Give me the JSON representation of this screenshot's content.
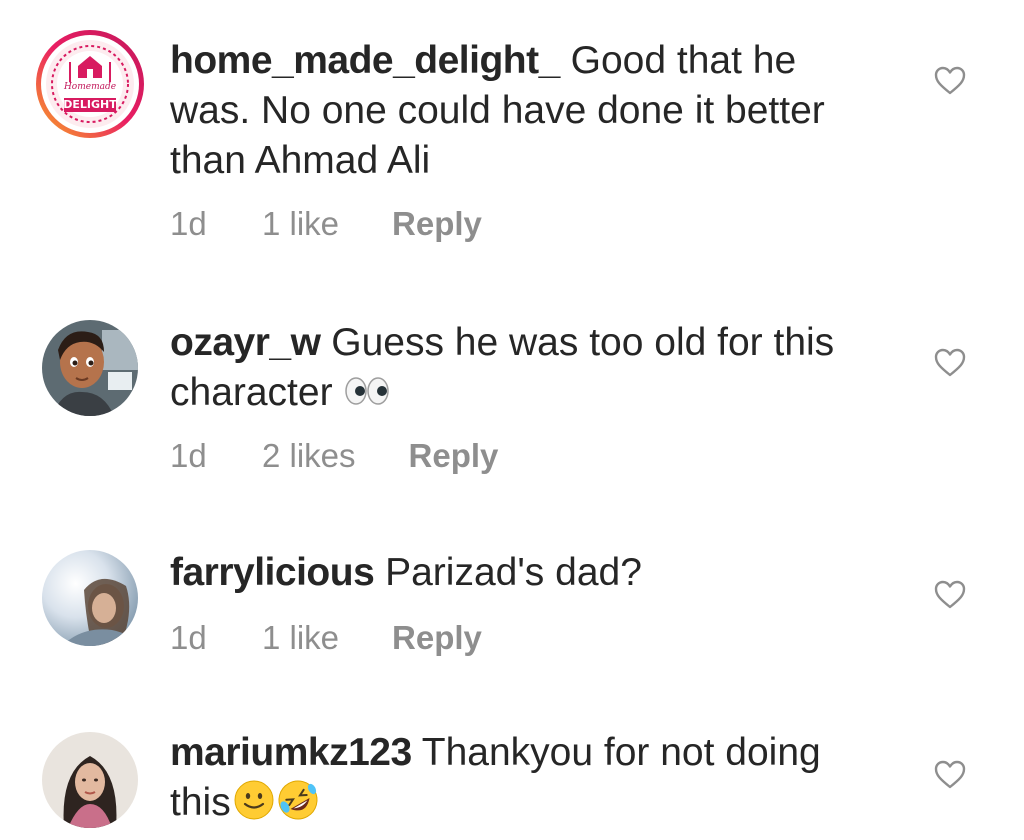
{
  "comments": [
    {
      "username": "home_made_delight_",
      "text_lines": [
        "Good that he",
        "was. No one  could have done it better",
        "than Ahmad Ali"
      ],
      "time": "1d",
      "likes": "1 like",
      "reply": "Reply",
      "avatar": "homemade-delight-logo",
      "avatar_text_top": "Homemade",
      "avatar_text_bottom": "DELIGHT"
    },
    {
      "username": "ozayr_w",
      "text_lines": [
        "Guess he was too old for this",
        "character"
      ],
      "emoji": "eyes",
      "time": "1d",
      "likes": "2 likes",
      "reply": "Reply",
      "avatar": "cartoon-character-photo"
    },
    {
      "username": "farrylicious",
      "text_lines": [
        "Parizad's dad?"
      ],
      "time": "1d",
      "likes": "1 like",
      "reply": "Reply",
      "avatar": "woman-portrait-photo"
    },
    {
      "username": "mariumkz123",
      "text_lines": [
        "Thankyou for not doing",
        "this"
      ],
      "emoji": [
        "slightly-smiling-face",
        "rolling-on-floor-laughing"
      ],
      "avatar": "woman-portrait-photo"
    }
  ],
  "colors": {
    "text": "#262626",
    "secondary": "#8e8e8e",
    "story_ring_start": "#f9a825",
    "story_ring_end": "#c2185b"
  }
}
